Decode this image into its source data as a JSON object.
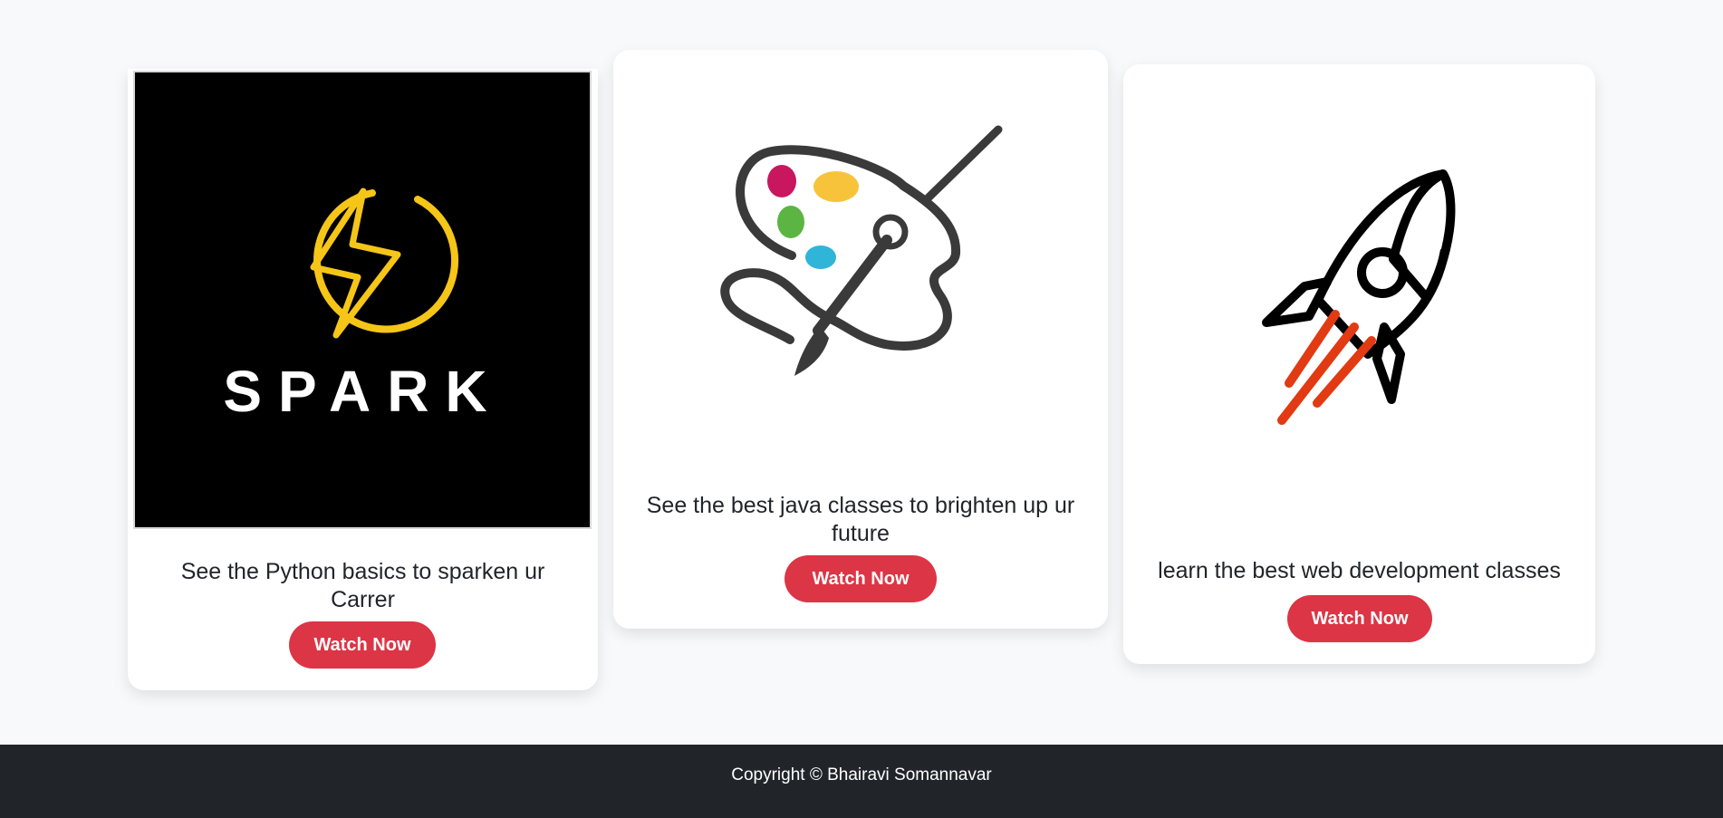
{
  "cards": [
    {
      "image_name": "spark-logo",
      "logo_text": "SPARK",
      "text": "See the Python basics to sparken ur Carrer",
      "button_label": "Watch Now"
    },
    {
      "image_name": "paint-palette-icon",
      "text": "See the best java classes to brighten up ur future",
      "button_label": "Watch Now"
    },
    {
      "image_name": "rocket-icon",
      "text": "learn the best web development classes",
      "button_label": "Watch Now"
    }
  ],
  "footer": {
    "copyright": "Copyright © Bhairavi Somannavar"
  },
  "colors": {
    "button": "#dc3545",
    "footer_bg": "#212529",
    "page_bg": "#f8f9fa",
    "spark_yellow": "#f5c518",
    "rocket_flame": "#e23a12"
  }
}
